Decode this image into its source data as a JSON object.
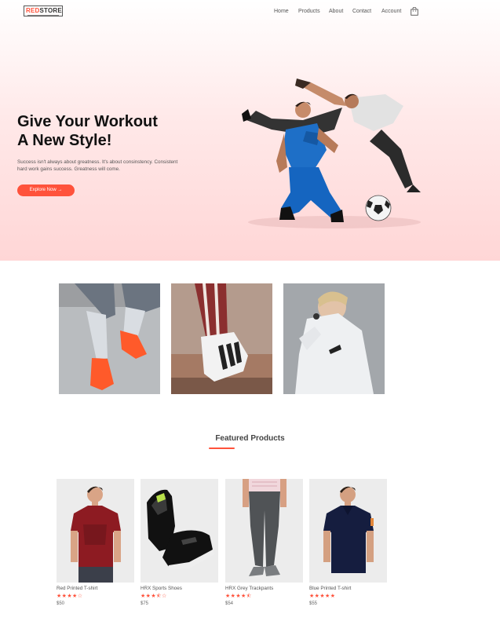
{
  "brand": {
    "red": "RED",
    "dark": "STORE"
  },
  "nav": {
    "items": [
      "Home",
      "Products",
      "About",
      "Contact",
      "Account"
    ]
  },
  "hero": {
    "title_line1": "Give Your Workout",
    "title_line2": "A New Style!",
    "subtitle_line1": "Success isn't always about greatness. It's about consinstency. Consistent",
    "subtitle_line2": "hard work gains success. Greatness will come.",
    "cta": "Explore Now →"
  },
  "featured": {
    "title": "Featured Products",
    "products": [
      {
        "name": "Red Printed T-shirt",
        "rating": 4,
        "stars": "★★★★☆",
        "price": "$50"
      },
      {
        "name": "HRX Sports Shoes",
        "rating": 3.5,
        "stars": "★★★⯪☆",
        "price": "$75"
      },
      {
        "name": "HRX Grey Trackpants",
        "rating": 4.5,
        "stars": "★★★★⯪",
        "price": "$54"
      },
      {
        "name": "Blue Printed T-shirt",
        "rating": 5,
        "stars": "★★★★★",
        "price": "$55"
      }
    ]
  },
  "colors": {
    "accent": "#ff523b",
    "hero_bg": "#ffd6d6"
  }
}
